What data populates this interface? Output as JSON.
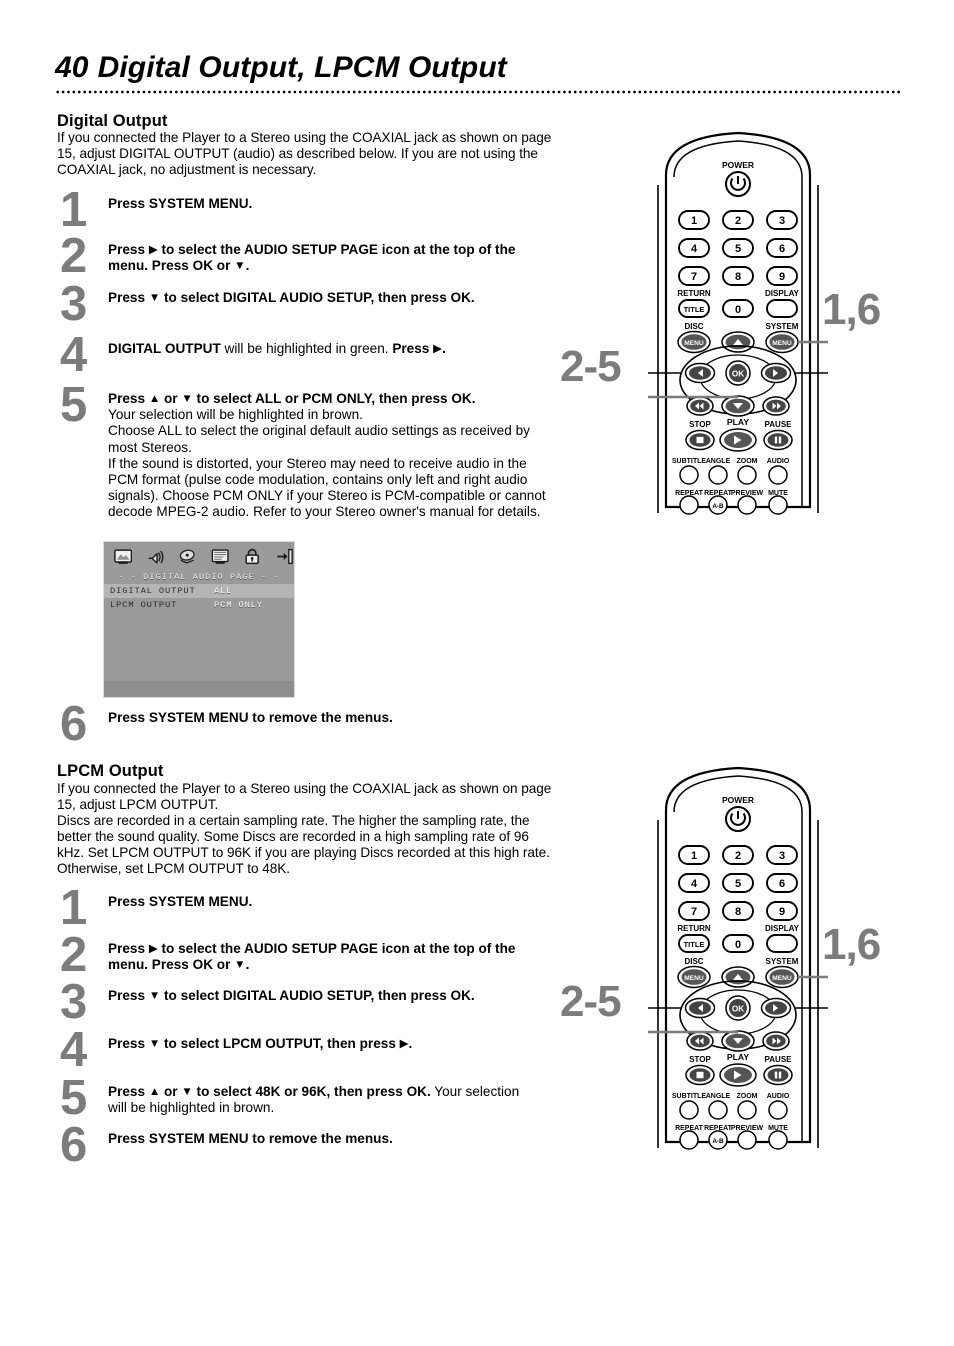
{
  "header": {
    "page_number": "40",
    "title": "Digital Output, LPCM Output"
  },
  "sections": [
    {
      "heading": "Digital Output",
      "intro": "If you connected the Player to a Stereo using the COAXIAL jack as shown on page 15, adjust DIGITAL OUTPUT (audio) as described below. If you are not using the COAXIAL jack, no adjustment is necessary.",
      "steps": [
        {
          "num": "1",
          "html": "<b>Press SYSTEM MENU.</b>"
        },
        {
          "num": "2",
          "html": "<b>Press <span class='arrow'>▶</span> to select the AUDIO SETUP PAGE icon at the top of the menu.  Press OK or <span class='arrow'>▼</span>.</b>"
        },
        {
          "num": "3",
          "html": "<b>Press <span class='arrow'>▼</span> to select DIGITAL AUDIO SETUP, then press OK.</b>"
        },
        {
          "num": "4",
          "html": "<b>DIGITAL OUTPUT</b> will be highlighted in green. <b>Press <span class='arrow'>▶</span>.</b>"
        },
        {
          "num": "5",
          "html": "<b>Press <span class='arrow'>▲</span> or <span class='arrow'>▼</span> to select  ALL or PCM ONLY, then press OK.</b><br>Your selection will be highlighted in brown.<br>Choose ALL to select the original default audio settings as received by most Stereos.<br>If the sound is distorted, your Stereo may need to receive audio in the PCM format (pulse code modulation, contains only left and right audio signals). Choose PCM ONLY if your Stereo is PCM-compatible or cannot decode MPEG-2 audio. Refer to your Stereo owner's manual for details."
        },
        {
          "num": "6",
          "html": "<b>Press SYSTEM MENU to remove the menus.</b>"
        }
      ]
    },
    {
      "heading": "LPCM Output",
      "intro": "If you connected the Player to a Stereo using the COAXIAL jack as shown on page 15, adjust LPCM OUTPUT.\nDiscs are recorded in a certain sampling rate.  The higher the sampling rate, the better the sound quality.  Some Discs are recorded in a high sampling rate of 96 kHz.  Set LPCM OUTPUT to 96K if you are playing Discs recorded at this high rate. Otherwise, set LPCM OUTPUT to 48K.",
      "steps": [
        {
          "num": "1",
          "html": "<b>Press SYSTEM MENU.</b>"
        },
        {
          "num": "2",
          "html": "<b>Press <span class='arrow'>▶</span> to select the AUDIO SETUP PAGE icon at the top of the menu.  Press OK or <span class='arrow'>▼</span>.</b>"
        },
        {
          "num": "3",
          "html": "<b>Press <span class='arrow'>▼</span> to select DIGITAL AUDIO SETUP, then press OK.</b>"
        },
        {
          "num": "4",
          "html": "<b>Press <span class='arrow'>▼</span> to select LPCM OUTPUT, then press <span class='arrow'>▶</span>.</b>"
        },
        {
          "num": "5",
          "html": "<b>Press <span class='arrow'>▲</span> or <span class='arrow'>▼</span> to select 48K or 96K, then press OK.</b> Your selection will be highlighted in brown."
        },
        {
          "num": "6",
          "html": "<b>Press SYSTEM MENU to remove the menus.</b>"
        }
      ]
    }
  ],
  "osd_screen": {
    "icons": [
      "general-setup-icon",
      "audio-setup-icon",
      "video-setup-icon",
      "preference-setup-icon",
      "password-lock-icon",
      "exit-setup-icon"
    ],
    "page_title": "- -  DIGITAL  AUDIO  PAGE  - -",
    "rows": [
      {
        "label": "DIGITAL OUTPUT",
        "value": "ALL",
        "selected": true
      },
      {
        "label": "LPCM OUTPUT",
        "value": "PCM ONLY",
        "selected": false
      }
    ]
  },
  "remote": {
    "power_label": "POWER",
    "numbers": [
      "1",
      "2",
      "3",
      "4",
      "5",
      "6",
      "7",
      "8",
      "9"
    ],
    "zero_label": "0",
    "return_label": "RETURN",
    "title_label": "TITLE",
    "display_label": "DISPLAY",
    "disc_label": "DISC",
    "disc_menu_label": "MENU",
    "system_label": "SYSTEM",
    "system_menu_label": "MENU",
    "ok_label": "OK",
    "stop_label": "STOP",
    "play_label": "PLAY",
    "pause_label": "PAUSE",
    "function_row1": [
      "SUBTITLE",
      "ANGLE",
      "ZOOM",
      "AUDIO"
    ],
    "function_row2": [
      "REPEAT",
      "REPEAT",
      "PREVIEW",
      "MUTE"
    ],
    "repeat_ab_label": "A-B"
  },
  "callouts": {
    "top_right": "1,6",
    "top_left": "2-5",
    "bottom_right": "1,6",
    "bottom_left": "2-5"
  },
  "colors": {
    "callout_gray": "#7c7c7c",
    "step_number_gray": "#7c7c7c",
    "osd_background": "#9a9a9a",
    "osd_selected_row": "#b4b4b4",
    "text_black": "#000000"
  }
}
